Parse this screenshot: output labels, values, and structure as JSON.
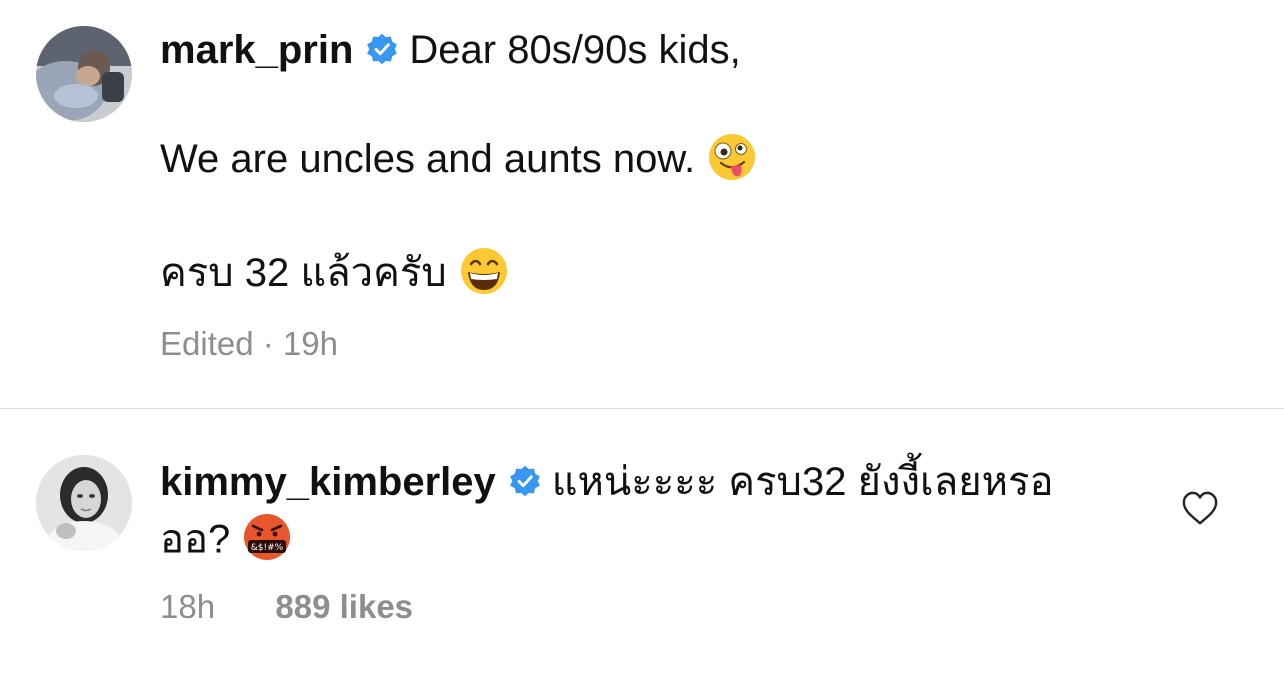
{
  "caption": {
    "username": "mark_prin",
    "line1": "Dear 80s/90s kids,",
    "line2": "We are uncles and aunts now.",
    "line3": "ครบ 32 แล้วครับ",
    "edited_label": "Edited",
    "separator": "·",
    "time": "19h",
    "emoji1": "zany-face",
    "emoji2": "grinning-face"
  },
  "comment": {
    "username": "kimmy_kimberley",
    "text_line1": "แหน่ะะะะ ครบ32 ยังงี้เลยหรอ",
    "text_line2": "ออ?",
    "emoji": "face-with-symbols-on-mouth",
    "time": "18h",
    "likes": "889 likes"
  },
  "colors": {
    "verified_blue": "#3897f0",
    "meta_gray": "#8e8e8e",
    "divider": "#dbdbdb"
  }
}
